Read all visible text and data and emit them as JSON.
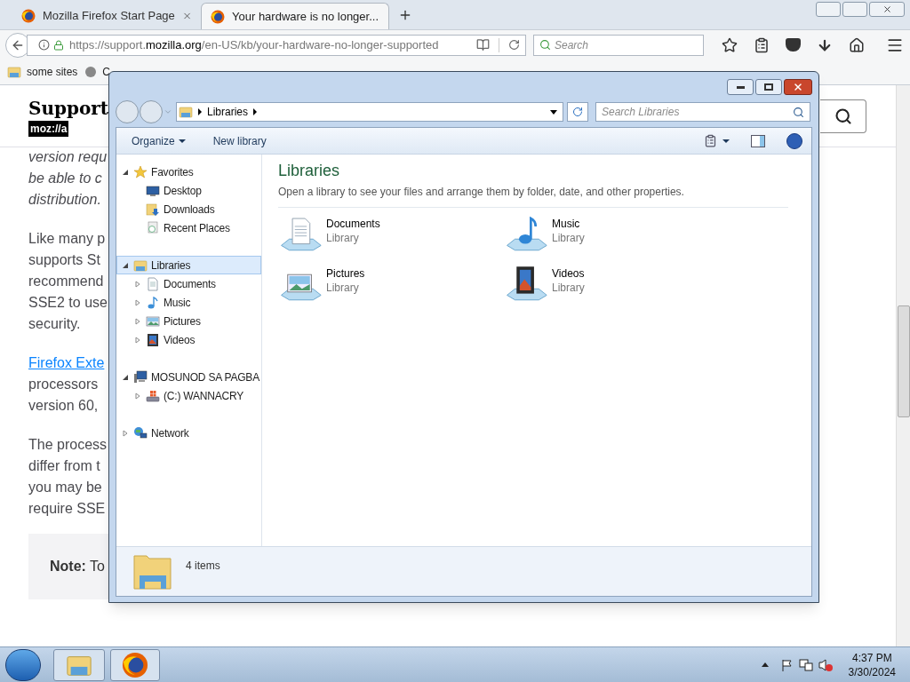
{
  "browser": {
    "tabs": [
      {
        "title": "Mozilla Firefox Start Page",
        "selected": false
      },
      {
        "title": "Your hardware is no longer...",
        "selected": true
      }
    ],
    "url": [
      {
        "text": "https://support.",
        "highlight": false
      },
      {
        "text": "mozilla.org",
        "highlight": true
      },
      {
        "text": "/en-US/kb/your-hardware-no-longer-supported",
        "highlight": false
      }
    ],
    "search": {
      "placeholder": "Search"
    },
    "bookmarks": [
      "some sites",
      "C"
    ]
  },
  "page": {
    "heading": "Support",
    "logo": "moz://a",
    "paragraphs": [
      {
        "italic": true,
        "lines": [
          {
            "text": "version requ",
            "link": false
          },
          {
            "text": "be able to c",
            "link": false
          },
          {
            "text": "distribution.",
            "link": false
          }
        ]
      },
      {
        "italic": false,
        "lines": [
          {
            "text": "Like many p",
            "link": false
          },
          {
            "text": "supports St",
            "link": false
          },
          {
            "text": "recommend",
            "link": false
          },
          {
            "text": "SSE2 to use",
            "link": false
          },
          {
            "text": "security.",
            "link": false
          }
        ]
      },
      {
        "italic": false,
        "lines": [
          {
            "text": "Firefox Exte",
            "link": true
          },
          {
            "text": "processors",
            "link": false
          },
          {
            "text": "version 60,",
            "link": false
          }
        ]
      },
      {
        "italic": false,
        "lines": [
          {
            "text": "The process",
            "link": false
          },
          {
            "text": "differ from t",
            "link": false
          },
          {
            "text": "you may be",
            "link": false
          },
          {
            "text": "require SSE",
            "link": false
          }
        ]
      }
    ],
    "note": {
      "label": "Note:",
      "text": "To"
    }
  },
  "explorer": {
    "breadcrumb": "Libraries",
    "search": {
      "placeholder": "Search Libraries"
    },
    "toolbar": [
      "Organize",
      "New library"
    ],
    "nav": [
      {
        "label": "Favorites",
        "kind": "favorites",
        "expanded": true,
        "selected": false,
        "children": [
          {
            "label": "Desktop",
            "kind": "desktop",
            "selected": false
          },
          {
            "label": "Downloads",
            "kind": "downloads",
            "selected": false
          },
          {
            "label": "Recent Places",
            "kind": "recent",
            "selected": false
          }
        ]
      },
      {
        "label": "Libraries",
        "kind": "libraries",
        "expanded": true,
        "selected": true,
        "children": [
          {
            "label": "Documents",
            "kind": "documents",
            "expanded": false,
            "selected": false
          },
          {
            "label": "Music",
            "kind": "music",
            "expanded": false,
            "selected": false
          },
          {
            "label": "Pictures",
            "kind": "pictures",
            "expanded": false,
            "selected": false
          },
          {
            "label": "Videos",
            "kind": "videos",
            "expanded": false,
            "selected": false
          }
        ]
      },
      {
        "label": "MOSUNOD SA PAGBA",
        "kind": "computer",
        "expanded": true,
        "selected": false,
        "children": [
          {
            "label": "(C:) WANNACRY",
            "kind": "drive",
            "expanded": false,
            "selected": false
          }
        ]
      },
      {
        "label": "Network",
        "kind": "network",
        "expanded": false,
        "selected": false
      }
    ],
    "title": "Libraries",
    "description": "Open a library to see your files and arrange them by folder, date, and other properties.",
    "libraries": [
      {
        "name": "Documents",
        "type": "Library",
        "kind": "documents"
      },
      {
        "name": "Music",
        "type": "Library",
        "kind": "music"
      },
      {
        "name": "Pictures",
        "type": "Library",
        "kind": "pictures"
      },
      {
        "name": "Videos",
        "type": "Library",
        "kind": "videos"
      }
    ],
    "status": "4 items"
  },
  "taskbar": {
    "time": "4:37 PM",
    "date": "3/30/2024"
  }
}
